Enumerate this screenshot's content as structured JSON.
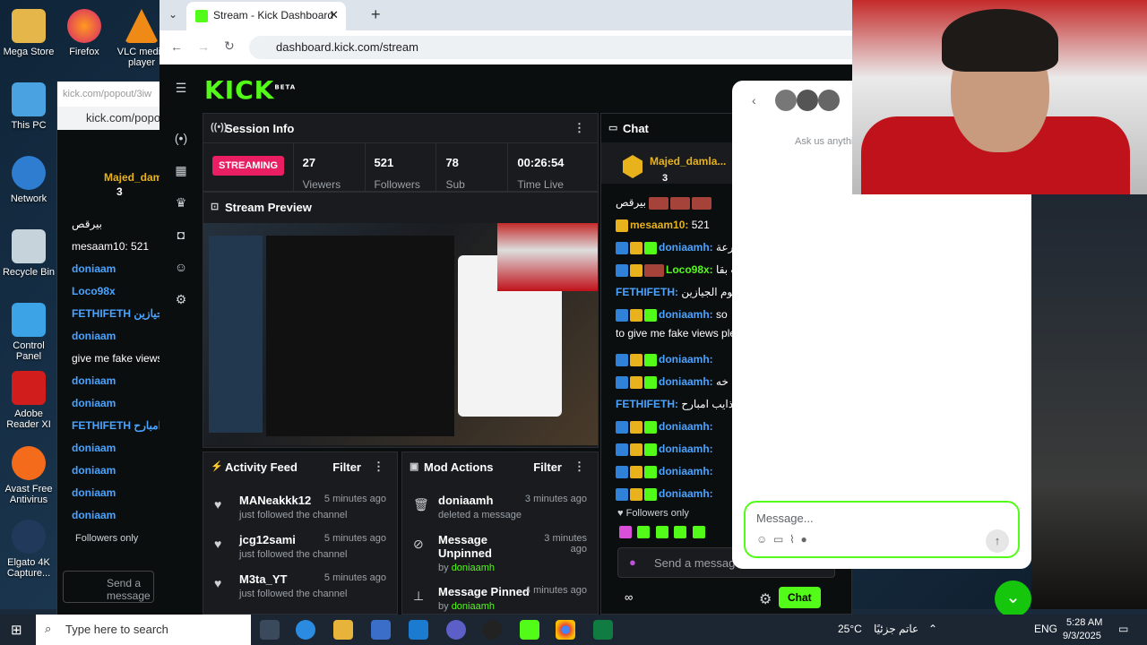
{
  "desktop": {
    "icons": [
      "Mega Store",
      "Firefox",
      "VLC media player",
      "This PC",
      "Network",
      "Recycle Bin",
      "Control Panel",
      "Adobe Reader XI",
      "Avast Free Antivirus",
      "Elgato 4K Capture..."
    ]
  },
  "browser": {
    "tab_title": "Stream - Kick Dashboard",
    "url": "dashboard.kick.com/stream"
  },
  "popout": {
    "url_label": "kick.com/popout/3iw",
    "url_bar": "kick.com/popou",
    "user": "Majed_dama",
    "count": "3"
  },
  "kick": {
    "logo": "KICK",
    "beta": "BETA",
    "session": {
      "title": "Session Info",
      "status": "STREAMING",
      "viewers": "27",
      "viewers_label": "Viewers",
      "followers": "521",
      "followers_label": "Followers",
      "subs": "78",
      "subs_label": "Sub",
      "time": "00:26:54",
      "time_label": "Time Live"
    },
    "preview": {
      "title": "Stream Preview"
    },
    "activity": {
      "title": "Activity Feed",
      "filter": "Filter",
      "items": [
        {
          "user": "MANeakkk12",
          "time": "5 minutes ago",
          "action": "just followed the channel"
        },
        {
          "user": "jcg12sami",
          "time": "5 minutes ago",
          "action": "just followed the channel"
        },
        {
          "user": "M3ta_YT",
          "time": "5 minutes ago",
          "action": "just followed the channel"
        }
      ]
    },
    "mod": {
      "title": "Mod Actions",
      "filter": "Filter",
      "items": [
        {
          "title": "doniaamh",
          "time": "3 minutes ago",
          "sub": "deleted a message"
        },
        {
          "title": "Message Unpinned",
          "time": "3 minutes ago",
          "by": "by ",
          "user": "doniaamh"
        },
        {
          "title": "Message Pinned",
          "time": "4 minutes ago",
          "by": "by ",
          "user": "doniaamh"
        }
      ]
    },
    "chat": {
      "title": "Chat",
      "pinned_user": "Majed_damla...",
      "pinned_count": "3",
      "lines": [
        {
          "user": "",
          "text": "بيرقص"
        },
        {
          "user": "mesaam10:",
          "text": " 521"
        },
        {
          "user": "doniaamh:",
          "text": " رعة"
        },
        {
          "user": "Loco98x:",
          "text": " ت بقا"
        },
        {
          "user": "FETHIFETH:",
          "text": " هجوم الجيازين"
        },
        {
          "user": "doniaamh:",
          "text": " so"
        },
        {
          "user": "",
          "text": "to give me fake views ple"
        },
        {
          "user": "doniaamh:",
          "text": ""
        },
        {
          "user": "doniaamh:",
          "text": " خه"
        },
        {
          "user": "FETHIFETH:",
          "text": " ريم مذايب امبارح"
        },
        {
          "user": "doniaamh:",
          "text": ""
        },
        {
          "user": "doniaamh:",
          "text": ""
        },
        {
          "user": "doniaamh:",
          "text": ""
        },
        {
          "user": "doniaamh:",
          "text": ""
        }
      ],
      "followers_only": "Followers only",
      "placeholder": "Send a message",
      "send": "Chat"
    }
  },
  "overlay": {
    "hint": "Ask us anythi",
    "placeholder": "Message..."
  },
  "taskbar": {
    "search": "Type here to search",
    "temp": "25°C",
    "weather": "عاتم جزئيًا",
    "lang": "ENG",
    "time": "5:28 AM",
    "date": "9/3/2025"
  },
  "popchat": {
    "lines": [
      "بيرقص",
      "mesaam10: 521",
      "doniaam",
      "Loco98x",
      "FETHIFETH الجيازين",
      "doniaam",
      "give me fake views",
      "doniaam",
      "doniaam",
      "FETHIFETH امبارح",
      "doniaam",
      "doniaam",
      "doniaam",
      "doniaam"
    ],
    "followers_only": "Followers only",
    "placeholder": "Send a message"
  }
}
